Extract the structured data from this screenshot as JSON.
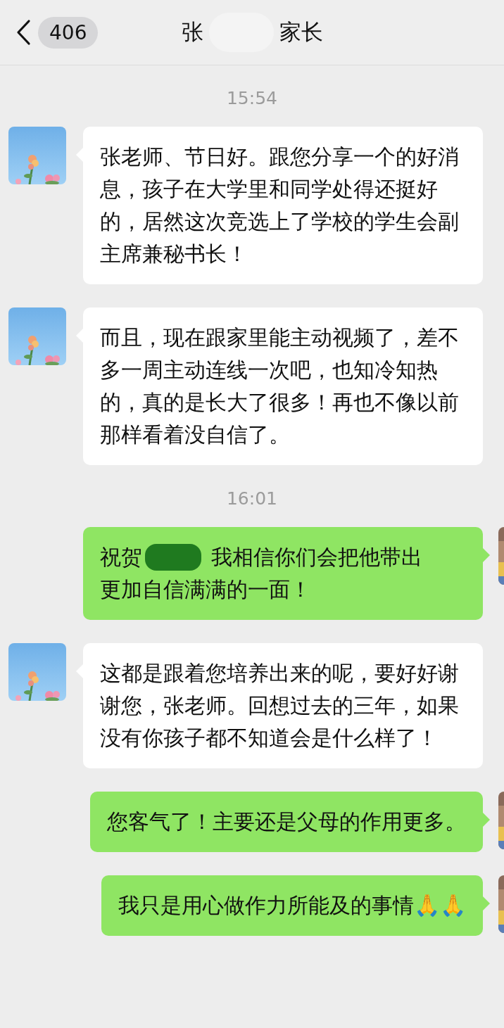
{
  "header": {
    "back_count": "406",
    "title_parts": [
      "张",
      "家长"
    ]
  },
  "messages": [
    {
      "kind": "time",
      "text": "15:54"
    },
    {
      "kind": "received",
      "parts": [
        "张老师、节日好。跟您分享一个的好消息，孩子在大学里和同学处得还挺好的，居然这次竞选上了学校的学生会副主席兼秘书长！"
      ]
    },
    {
      "kind": "received",
      "parts": [
        "而且，现在跟家里能主动视频了，差不多一周主动连线一次吧，也知冷知热的，真的是长大了很多！再也不像以前那样看着没自信了。"
      ]
    },
    {
      "kind": "time",
      "text": "16:01"
    },
    {
      "kind": "sent",
      "parts": [
        {
          "text": "祝贺",
          "redacted_after": true
        },
        {
          "text": "我相信你们会把他带出",
          "redacted_after": false
        },
        {
          "text": "更加自信满满的一面！",
          "redacted_after": false
        }
      ]
    },
    {
      "kind": "received",
      "parts": [
        "这都是跟着您培养出来的呢，要好好谢谢您，张老师。回想过去的三年，如果没有你孩子都不知道会是什么样了！"
      ]
    },
    {
      "kind": "sent",
      "parts": [
        "您客气了！主要还是父母的作用更多。"
      ]
    },
    {
      "kind": "sent",
      "parts": [
        "我只是用心做作力所能及的事情🙏🙏"
      ]
    }
  ]
}
